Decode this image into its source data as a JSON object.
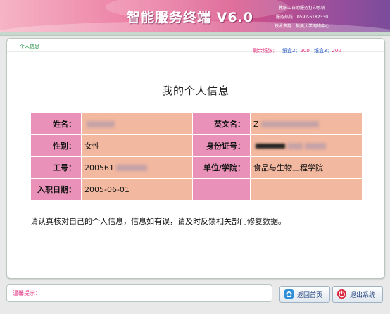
{
  "header": {
    "app_title": "智能服务终端 V6.0",
    "system_name": "教职工自助服务打印系统",
    "hotline": "服务热线：0592-6182330",
    "support": "技术支持：集美大学网络中心"
  },
  "status": {
    "tab_label": "个人信息",
    "paper_remaining_label": "剩余纸张：",
    "tray2_label": "纸盒2：",
    "tray2_value": "200",
    "tray3_label": "纸盒3：",
    "tray3_value": "200"
  },
  "page_title": "我的个人信息",
  "fields": {
    "name": {
      "label": "姓名：",
      "value": ""
    },
    "english_name": {
      "label": "英文名：",
      "value": "Z"
    },
    "gender": {
      "label": "性别：",
      "value": "女性"
    },
    "id_number": {
      "label": "身份证号：",
      "value": ""
    },
    "staff_no": {
      "label": "工号：",
      "value": "200561"
    },
    "unit": {
      "label": "单位/学院：",
      "value": "食品与生物工程学院"
    },
    "entry_date": {
      "label": "入职日期：",
      "value": "2005-06-01"
    },
    "empty_label": "",
    "empty_value": ""
  },
  "note": "请认真核对自己的个人信息，信息如有误，请及时反馈相关部门修复数据。",
  "footer": {
    "hint_label": "温馨提示：",
    "home_button": "返回首页",
    "exit_button": "退出系统"
  },
  "colors": {
    "label_cell": "#e991b9",
    "value_cell": "#f3b8a0",
    "accent": "#e0267a"
  },
  "icons": {
    "home": "home-icon",
    "exit": "power-icon"
  }
}
